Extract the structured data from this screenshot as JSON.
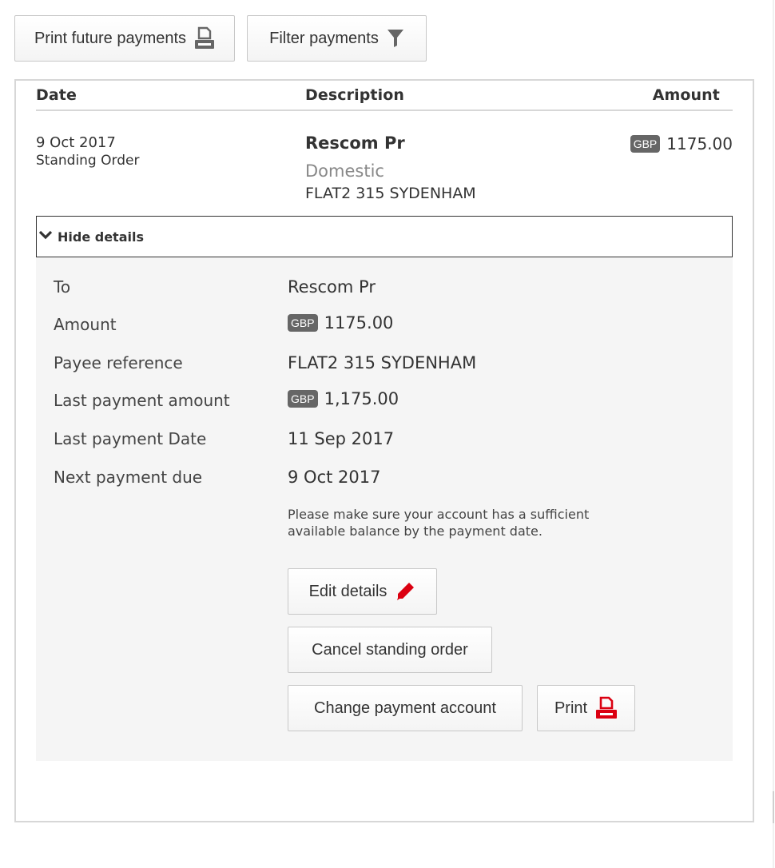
{
  "toolbar": {
    "print_future_label": "Print future payments",
    "filter_label": "Filter payments"
  },
  "table": {
    "headers": {
      "date": "Date",
      "description": "Description",
      "amount": "Amount"
    },
    "row": {
      "date": "9 Oct 2017",
      "type": "Standing Order",
      "payee": "Rescom Pr",
      "payment_type": "Domestic",
      "reference": "FLAT2 315 SYDENHAM",
      "currency": "GBP",
      "amount": "1175.00"
    }
  },
  "details_toggle": {
    "label": "Hide details",
    "icon": "chevron-down-icon"
  },
  "details": {
    "to_label": "To",
    "to_value": "Rescom Pr",
    "amount_label": "Amount",
    "amount_currency": "GBP",
    "amount_value": "1175.00",
    "payee_ref_label": "Payee reference",
    "payee_ref_value": "FLAT2 315 SYDENHAM",
    "last_amount_label": "Last payment amount",
    "last_amount_currency": "GBP",
    "last_amount_value": "1,175.00",
    "last_date_label": "Last payment Date",
    "last_date_value": "11 Sep 2017",
    "next_due_label": "Next payment due",
    "next_due_value": "9 Oct 2017",
    "notice": "Please make sure your account has a sufficient available balance by the payment date."
  },
  "actions": {
    "edit_label": "Edit details",
    "cancel_label": "Cancel standing order",
    "change_account_label": "Change payment account",
    "print_label": "Print"
  },
  "colors": {
    "accent_red": "#db0011",
    "badge_grey": "#666666",
    "icon_grey": "#666666"
  }
}
